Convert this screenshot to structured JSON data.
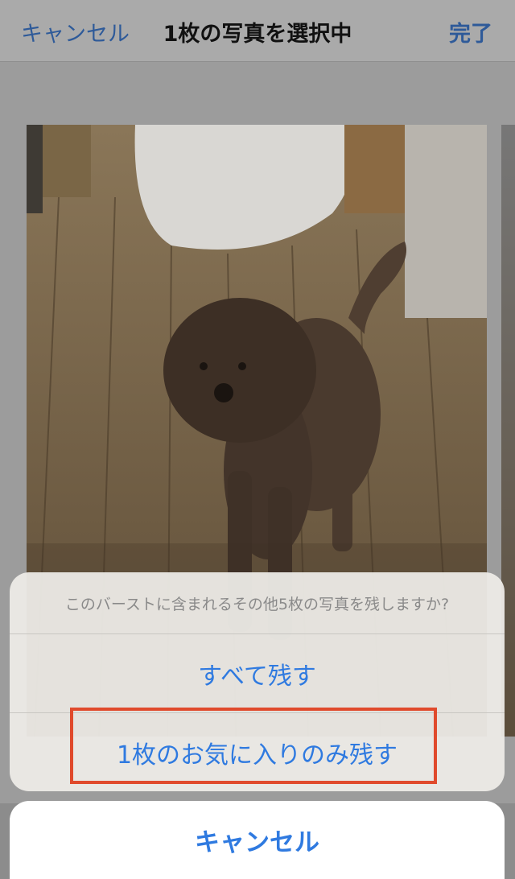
{
  "navbar": {
    "cancel_label": "キャンセル",
    "title": "1枚の写真を選択中",
    "done_label": "完了"
  },
  "photo": {
    "icon": "dog-photo"
  },
  "action_sheet": {
    "message": "このバーストに含まれるその他5枚の写真を残しますか?",
    "keep_all_label": "すべて残す",
    "keep_favorite_label": "1枚のお気に入りのみ残す",
    "cancel_label": "キャンセル"
  },
  "colors": {
    "accent": "#2f7ae0",
    "highlight": "#e04a2c"
  }
}
